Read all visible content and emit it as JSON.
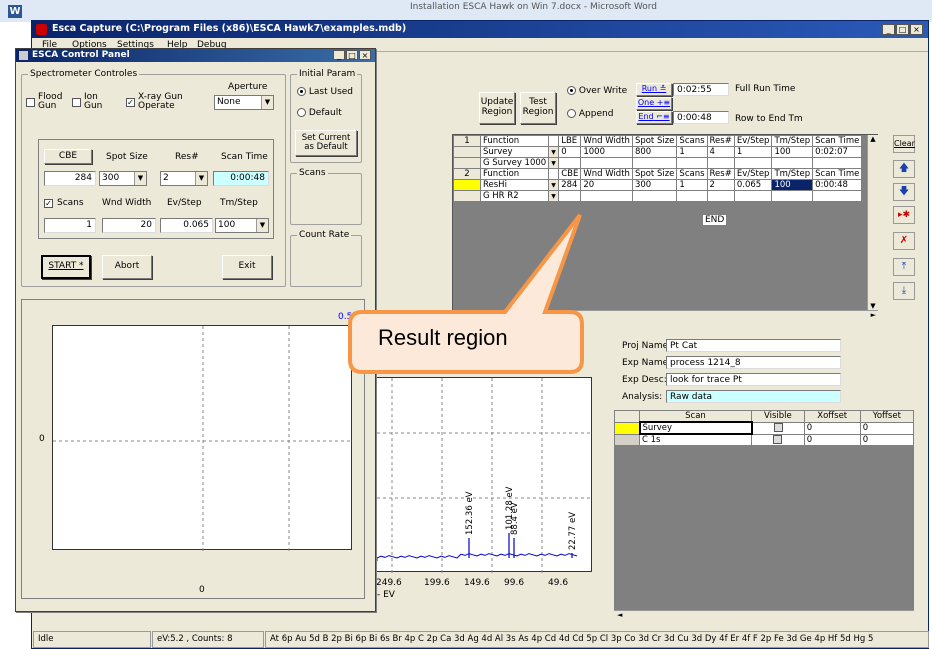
{
  "word_title": "Installation ESCA Hawk on Win 7.docx - Microsoft Word",
  "main": {
    "title": "Esca Capture (C:\\Program Files (x86)\\ESCA Hawk7\\examples.mdb)",
    "menu": [
      "File",
      "Options",
      "Settings",
      "Help",
      "Debug"
    ],
    "update_region": "Update\nRegion",
    "test_region": "Test\nRegion",
    "overwrite_label": "Over Write",
    "append_label": "Append",
    "run_label": "Run",
    "one_label": "One",
    "end_label": "End",
    "run_time": "0:02:55",
    "full_run_time_label": "Full Run Time",
    "end_time": "0:00:48",
    "row_to_end_label": "Row to End Tm",
    "clear_label": "Clear",
    "table": {
      "headers": [
        "Function",
        "LBE",
        "Wnd Width",
        "Spot Size",
        "Scans",
        "Res#",
        "Ev/Step",
        "Tm/Step",
        "Scan Time"
      ],
      "rows": [
        {
          "num": "1",
          "cells": [
            "Function",
            "LBE",
            "Wnd Width",
            "Spot Size",
            "Scans",
            "Res#",
            "Ev/Step",
            "Tm/Step",
            "Scan Time"
          ],
          "header": true
        },
        {
          "num": "",
          "cells": [
            "Survey",
            "0",
            "1000",
            "800",
            "1",
            "4",
            "1",
            "100",
            "0:02:07"
          ]
        },
        {
          "num": "",
          "cells": [
            "G Survey 1000",
            "",
            "",
            "",
            "",
            "",
            "",
            "",
            ""
          ]
        },
        {
          "num": "2",
          "cells": [
            "Function",
            "CBE",
            "Wnd Width",
            "Spot Size",
            "Scans",
            "Res#",
            "Ev/Step",
            "Tm/Step",
            "Scan Time"
          ],
          "header": true
        },
        {
          "num": "",
          "cells": [
            "ResHi",
            "284",
            "20",
            "300",
            "1",
            "2",
            "0.065",
            "100",
            "0:00:48"
          ]
        },
        {
          "num": "",
          "cells": [
            "G HR R2",
            "",
            "",
            "",
            "",
            "",
            "",
            "",
            ""
          ]
        }
      ],
      "end_label": "END"
    },
    "proj_name_label": "Proj Name:",
    "proj_name": "Pt Cat",
    "exp_name_label": "Exp Name:",
    "exp_name": "process 1214_8",
    "exp_desc_label": "Exp Desc:",
    "exp_desc": "look for trace Pt",
    "analysis_label": "Analysis:",
    "analysis": "Raw data",
    "scan_table": {
      "headers": [
        "Scan",
        "Visible",
        "Xoffset",
        "Yoffset"
      ],
      "rows": [
        {
          "scan": "Survey",
          "xoffset": "0",
          "yoffset": "0",
          "color": "#ffff00"
        },
        {
          "scan": "C 1s",
          "xoffset": "0",
          "yoffset": "0",
          "color": "#d4d0c8"
        }
      ]
    },
    "peaks": [
      "152.36 eV",
      "101.28 eV",
      "88.4 eV",
      "22.77 eV"
    ],
    "x_ticks": [
      "249.6",
      "199.6",
      "149.6",
      "99.6",
      "49.6"
    ],
    "x_unit": "- EV",
    "status": {
      "idle": "Idle",
      "counts": "eV:5.2 , Counts: 8",
      "elements": "At 6p  Au 5d  B 2p  Bi 6p  Bi 6s  Br 4p  C 2p  Ca 3d  Ag 4d  Al 3s  As 4p  Cd 4d  Cd 5p  Cl 3p  Co 3d  Cr 3d  Cu 3d  Dy 4f  Er 4f  F 2p  Fe 3d  Ge 4p  Hf 5d  Hg 5"
    }
  },
  "panel": {
    "title": "ESCA Control Panel",
    "spectrometer_label": "Spectrometer Controles",
    "flood_gun": "Flood\nGun",
    "ion_gun": "Ion\nGun",
    "xray_gun": "X-ray Gun\nOperate",
    "aperture_label": "Aperture",
    "aperture_value": "None",
    "cbe_label": "CBE",
    "spot_size_label": "Spot Size",
    "res_label": "Res#",
    "scan_time_label": "Scan Time",
    "cbe_value": "284",
    "spot_size_value": "300",
    "res_value": "2",
    "scan_time_value": "0:00:48",
    "scans_label": "Scans",
    "wnd_width_label": "Wnd Width",
    "ev_step_label": "Ev/Step",
    "tm_step_label": "Tm/Step",
    "scans_value": "1",
    "wnd_width_value": "20",
    "ev_step_value": "0.065",
    "tm_step_value": "100",
    "start_label": "START *",
    "abort_label": "Abort",
    "exit_label": "Exit",
    "initial_param_label": "Initial Param",
    "last_used_label": "Last Used",
    "default_label": "Default",
    "set_current_label": "Set Current\nas Default",
    "scans_group_label": "Scans",
    "count_rate_label": "Count Rate",
    "plot_y_tick": "0",
    "plot_x_tick": "0",
    "plot_corner_value": "0.5"
  },
  "callout": {
    "text": "Result region",
    "color": "#f79646"
  }
}
